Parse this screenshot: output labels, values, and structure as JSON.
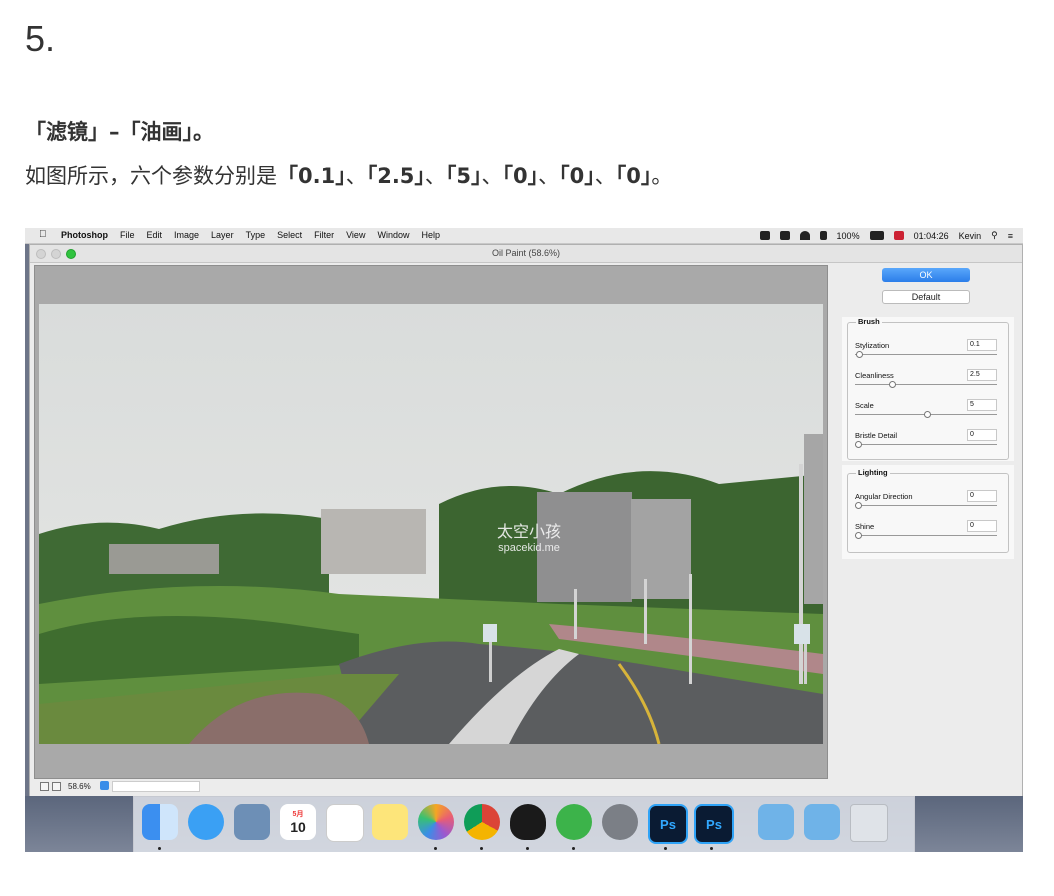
{
  "step_number": "5.",
  "instruction_line1": "「滤镜」–「油画」。",
  "instruction_line2_prefix": "如图所示，六个参数分别是",
  "instruction_line2_values": [
    "「0.1」",
    "「2.5」",
    "「5」",
    "「0」",
    "「0」",
    "「0」"
  ],
  "instruction_line2_separator": "、",
  "instruction_line2_end": "。",
  "menubar": {
    "app": "Photoshop",
    "items": [
      "File",
      "Edit",
      "Image",
      "Layer",
      "Type",
      "Select",
      "Filter",
      "View",
      "Window",
      "Help"
    ],
    "battery": "100%",
    "clock": "01:04:26",
    "user": "Kevin"
  },
  "window": {
    "title": "Oil Paint (58.6%)",
    "zoom": "58.6%"
  },
  "watermark": {
    "main": "太空小孩",
    "sub": "spacekid.me"
  },
  "panel": {
    "ok_label": "OK",
    "default_label": "Default",
    "brush": {
      "title": "Brush",
      "params": [
        {
          "label": "Stylization",
          "value": "0.1",
          "fraction": 0.01
        },
        {
          "label": "Cleanliness",
          "value": "2.5",
          "fraction": 0.25
        },
        {
          "label": "Scale",
          "value": "5",
          "fraction": 0.5
        },
        {
          "label": "Bristle Detail",
          "value": "0",
          "fraction": 0.0
        }
      ]
    },
    "lighting": {
      "title": "Lighting",
      "params": [
        {
          "label": "Angular Direction",
          "value": "0",
          "fraction": 0.0
        },
        {
          "label": "Shine",
          "value": "0",
          "fraction": 0.0
        }
      ]
    }
  },
  "dock": {
    "calendar_month": "5月",
    "calendar_day": "10",
    "ps_label": "Ps",
    "apps": [
      "finder-icon",
      "messages-icon",
      "preview-icon",
      "calendar-icon",
      "reminders-icon",
      "notes-icon",
      "photos-icon",
      "chrome-icon",
      "qq-icon",
      "wechat-icon",
      "system-preferences-icon",
      "photoshop-icon",
      "photoshop-icon",
      "app-store-folder-icon",
      "downloads-folder-icon",
      "trash-icon"
    ]
  }
}
